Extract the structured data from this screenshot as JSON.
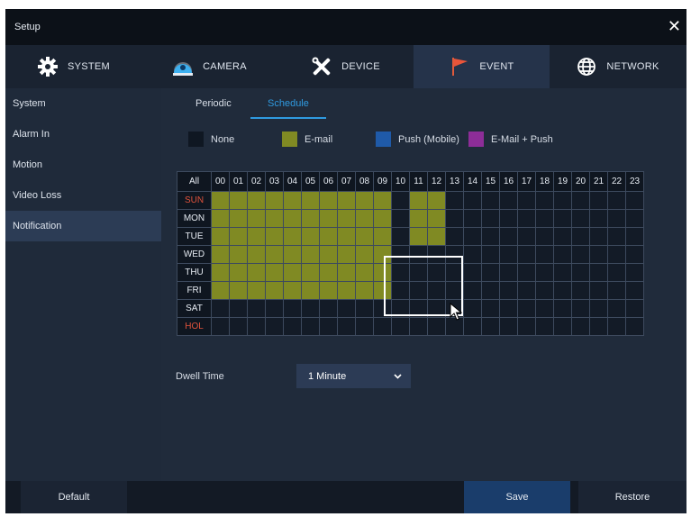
{
  "window": {
    "title": "Setup"
  },
  "tabs": [
    {
      "label": "SYSTEM",
      "icon": "gear-icon"
    },
    {
      "label": "CAMERA",
      "icon": "camera-icon"
    },
    {
      "label": "DEVICE",
      "icon": "tools-icon"
    },
    {
      "label": "EVENT",
      "icon": "flag-icon"
    },
    {
      "label": "NETWORK",
      "icon": "globe-icon"
    }
  ],
  "active_tab": "EVENT",
  "sidebar": {
    "items": [
      {
        "label": "System"
      },
      {
        "label": "Alarm In"
      },
      {
        "label": "Motion"
      },
      {
        "label": "Video Loss"
      },
      {
        "label": "Notification"
      }
    ],
    "active": "Notification"
  },
  "subtabs": [
    {
      "label": "Periodic"
    },
    {
      "label": "Schedule"
    }
  ],
  "active_subtab": "Schedule",
  "legend": [
    {
      "label": "None",
      "color": "#0f1722"
    },
    {
      "label": "E-mail",
      "color": "#808a23"
    },
    {
      "label": "Push (Mobile)",
      "color": "#1f5aa8"
    },
    {
      "label": "E-Mail + Push",
      "color": "#8d2d98"
    }
  ],
  "schedule": {
    "all_label": "All",
    "hours": [
      "00",
      "01",
      "02",
      "03",
      "04",
      "05",
      "06",
      "07",
      "08",
      "09",
      "10",
      "11",
      "12",
      "13",
      "14",
      "15",
      "16",
      "17",
      "18",
      "19",
      "20",
      "21",
      "22",
      "23"
    ],
    "days": [
      {
        "label": "SUN",
        "red": true,
        "email_hours": [
          0,
          1,
          2,
          3,
          4,
          5,
          6,
          7,
          8,
          9,
          11,
          12
        ]
      },
      {
        "label": "MON",
        "red": false,
        "email_hours": [
          0,
          1,
          2,
          3,
          4,
          5,
          6,
          7,
          8,
          9,
          11,
          12
        ]
      },
      {
        "label": "TUE",
        "red": false,
        "email_hours": [
          0,
          1,
          2,
          3,
          4,
          5,
          6,
          7,
          8,
          9,
          11,
          12
        ]
      },
      {
        "label": "WED",
        "red": false,
        "email_hours": [
          0,
          1,
          2,
          3,
          4,
          5,
          6,
          7,
          8,
          9
        ]
      },
      {
        "label": "THU",
        "red": false,
        "email_hours": [
          0,
          1,
          2,
          3,
          4,
          5,
          6,
          7,
          8,
          9
        ]
      },
      {
        "label": "FRI",
        "red": false,
        "email_hours": [
          0,
          1,
          2,
          3,
          4,
          5,
          6,
          7,
          8,
          9
        ]
      },
      {
        "label": "SAT",
        "red": false,
        "email_hours": []
      },
      {
        "label": "HOL",
        "red": true,
        "email_hours": []
      }
    ]
  },
  "dwell": {
    "label": "Dwell Time",
    "value": "1 Minute"
  },
  "footer": {
    "default_label": "Default",
    "save_label": "Save",
    "restore_label": "Restore"
  }
}
